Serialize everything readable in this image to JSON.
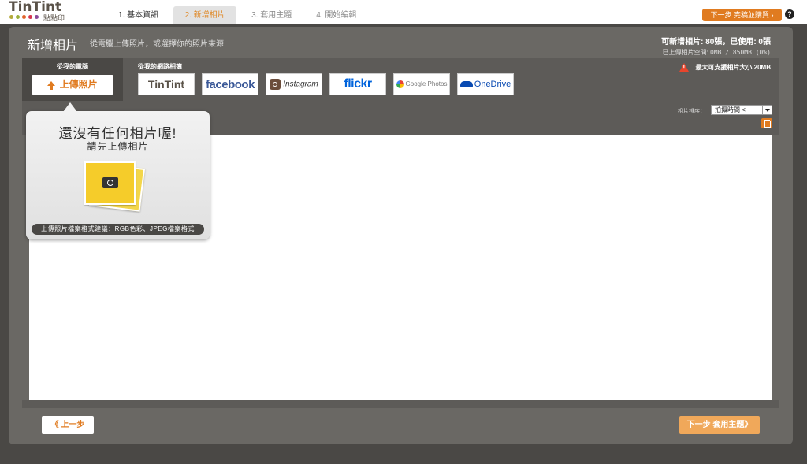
{
  "app": {
    "logo_text": "TinTint",
    "logo_sub": "點點印",
    "logo_dot_colors": [
      "#b5a93a",
      "#9bb03a",
      "#e0632a",
      "#d6364f",
      "#8a4a9a"
    ]
  },
  "steps": [
    {
      "label": "1. 基本資訊"
    },
    {
      "label": "2. 新增相片"
    },
    {
      "label": "3. 套用主題"
    },
    {
      "label": "4. 開始編輯"
    }
  ],
  "top_next_label": "下一步 完稿並購買 ›",
  "help_label": "?",
  "page": {
    "title": "新增相片",
    "subtitle": "從電腦上傳照片，或選擇你的照片來源",
    "quota_text": "可新增相片: 80張，已使用: 0張",
    "space_label": "已上傳相片空間:",
    "space_value": "0MB / 850MB (0%)"
  },
  "sources": {
    "local_label": "從我的電腦",
    "upload_label": "上傳照片",
    "web_label": "從我的網路相簿",
    "web_services": [
      "TinTint",
      "facebook",
      "Instagram",
      "flickr",
      "Google Photos",
      "OneDrive"
    ],
    "max_size_text": "最大可支援相片大小 20MB"
  },
  "sort": {
    "label": "相片排序：",
    "selected": "拍攝時間 <"
  },
  "popup": {
    "title": "還沒有任何相片喔!",
    "subtitle": "請先上傳相片",
    "hint": "上傳照片檔案格式建議：RGB色彩、JPEG檔案格式"
  },
  "nav": {
    "prev_label": "《 上一步",
    "next_label": "下一步  套用主題》"
  },
  "colors": {
    "accent": "#e07b20",
    "panel": "#6a6864",
    "background": "#4a4845"
  }
}
